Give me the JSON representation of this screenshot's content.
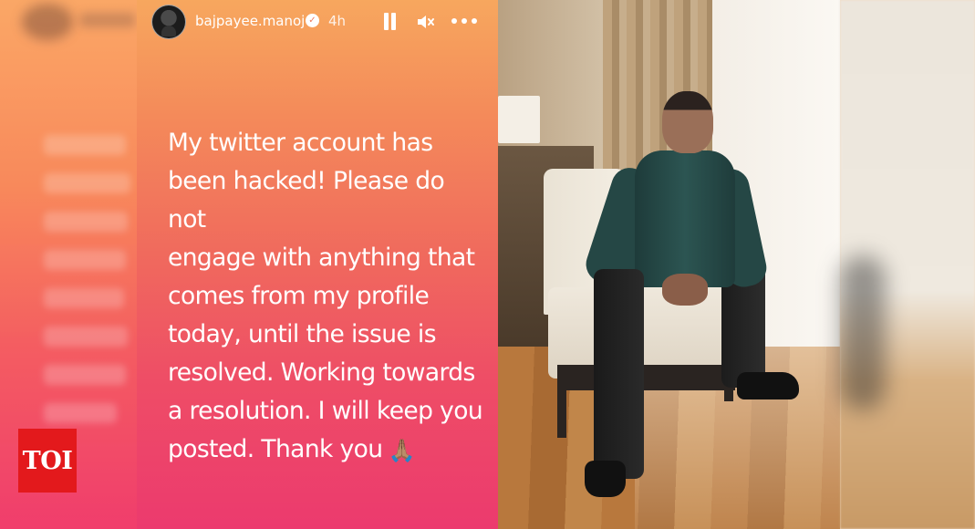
{
  "story": {
    "username": "bajpayee.manoj",
    "verified_icon": "verified-badge-icon",
    "posted_ago": "4h",
    "controls": {
      "pause_icon": "pause-icon",
      "mute_icon": "speaker-muted-icon",
      "more_icon": "more-options-icon"
    },
    "message": "My twitter account has\nbeen hacked! Please do not\nengage with anything that\ncomes from my profile\ntoday, until the issue is\nresolved. Working towards\na resolution. I will keep you\nposted. Thank you",
    "emoji": "🙏🏽",
    "colors": {
      "gradient_top": "#f7a75e",
      "gradient_bottom": "#ec3a6e"
    }
  },
  "watermark": {
    "logo_text": "TOI",
    "logo_color": "#e3191c"
  }
}
